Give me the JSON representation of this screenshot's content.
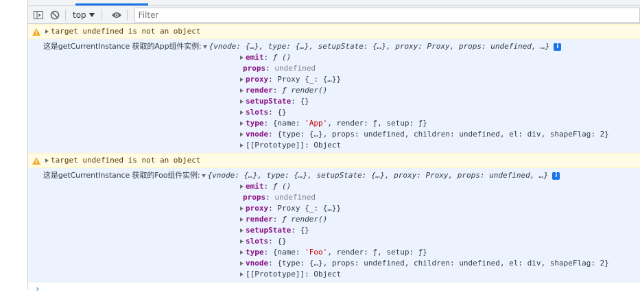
{
  "toolbar": {
    "context_label": "top",
    "filter_placeholder": "Filter"
  },
  "messages": [
    {
      "warning": "target undefined is not an object",
      "label": "这是getCurrentInstance 获取的App组件实例:",
      "summary": "{vnode: {…}, type: {…}, setupState: {…}, proxy: Proxy, props: undefined, …}",
      "props": {
        "emit": "ƒ ()",
        "props_val": "undefined",
        "proxy": "Proxy {_: {…}}",
        "render": "ƒ render()",
        "setupState": "{}",
        "slots": "{}",
        "type_pre": "{name: ",
        "type_name": "'App'",
        "type_post": ", render: ƒ, setup: ƒ}",
        "vnode": "{type: {…}, props: undefined, children: undefined, el: div, shapeFlag: 2}",
        "prototype": "[[Prototype]]: Object"
      }
    },
    {
      "warning": "target undefined is not an object",
      "label": "这是getCurrentInstance 获取的Foo组件实例:",
      "summary": "{vnode: {…}, type: {…}, setupState: {…}, proxy: Proxy, props: undefined, …}",
      "props": {
        "emit": "ƒ ()",
        "props_val": "undefined",
        "proxy": "Proxy {_: {…}}",
        "render": "ƒ render()",
        "setupState": "{}",
        "slots": "{}",
        "type_pre": "{name: ",
        "type_name": "'Foo'",
        "type_post": ", render: ƒ, setup: ƒ}",
        "vnode": "{type: {…}, props: undefined, children: undefined, el: div, shapeFlag: 2}",
        "prototype": "[[Prototype]]: Object"
      }
    }
  ],
  "prompt_symbol": "›"
}
